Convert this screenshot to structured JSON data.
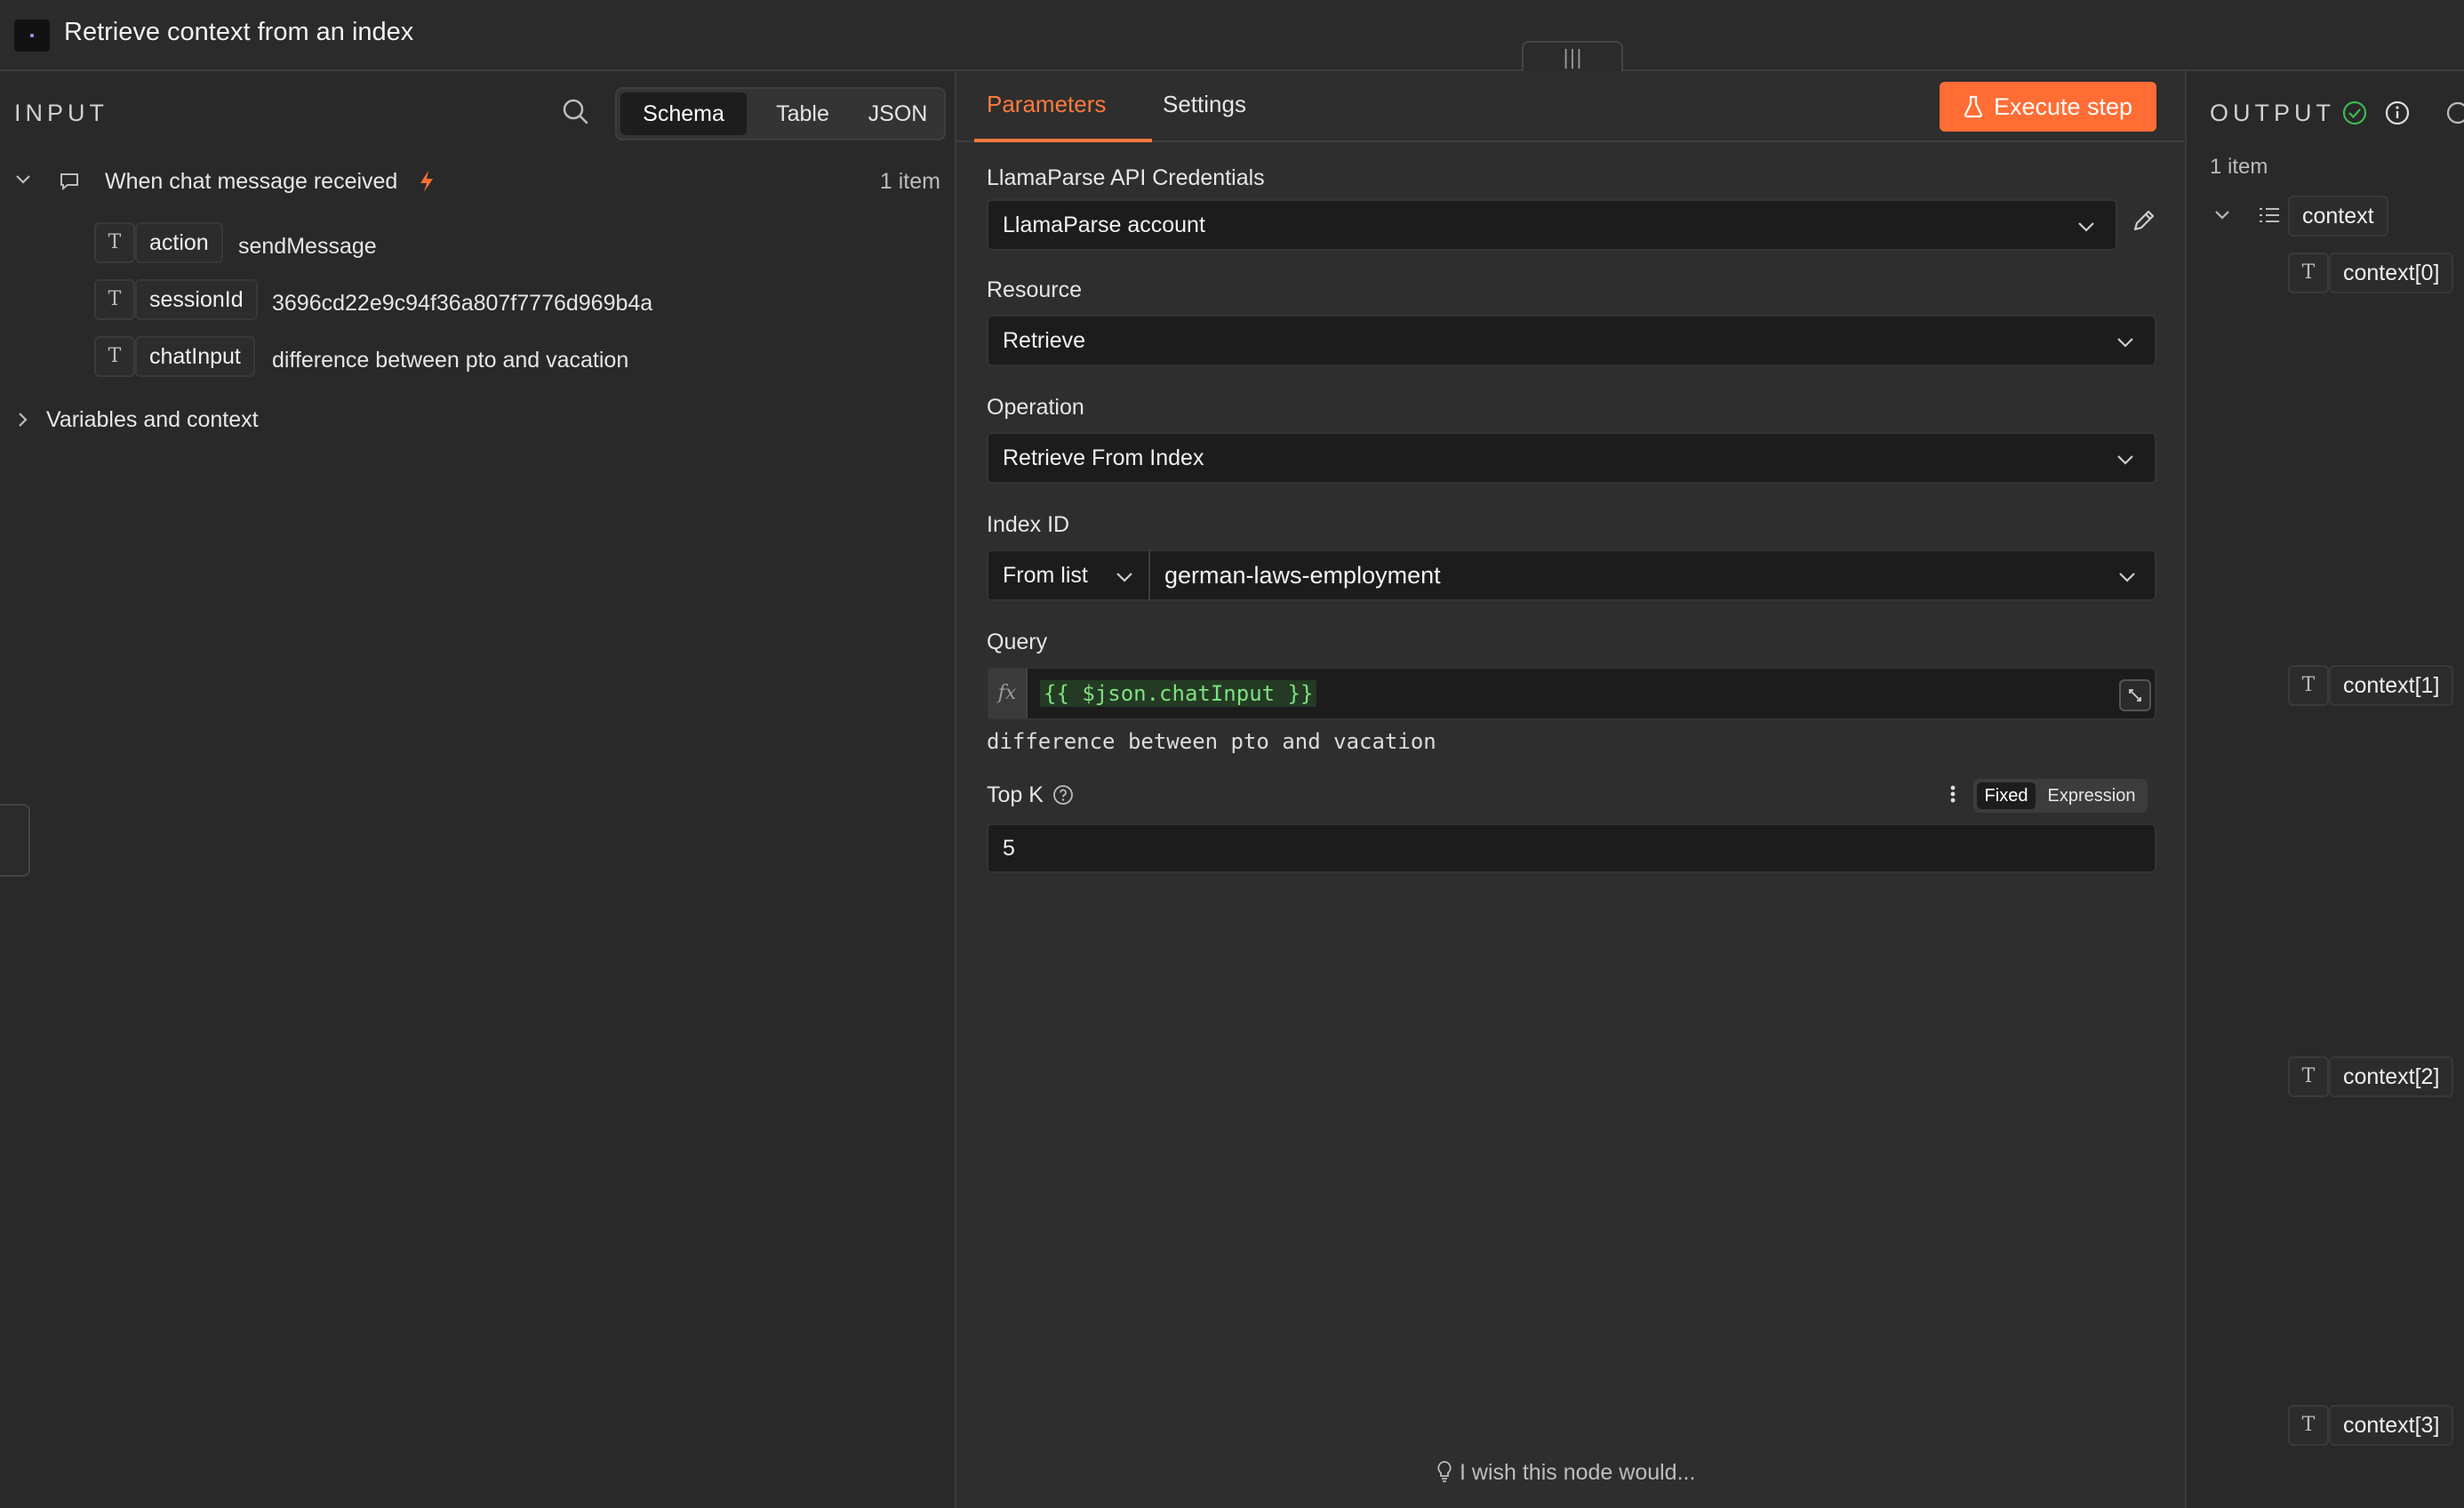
{
  "header": {
    "title": "Retrieve context from an index",
    "drag_handle": "|||"
  },
  "input": {
    "label": "INPUT",
    "views": [
      "Schema",
      "Table",
      "JSON"
    ],
    "active_view": "Schema",
    "trigger": {
      "name": "When chat message received",
      "count": "1 item",
      "fields": [
        {
          "type": "T",
          "key": "action",
          "value": "sendMessage"
        },
        {
          "type": "T",
          "key": "sessionId",
          "value": "3696cd22e9c94f36a807f7776d969b4a"
        },
        {
          "type": "T",
          "key": "chatInput",
          "value": "difference between pto and vacation"
        }
      ]
    },
    "variables_label": "Variables and context"
  },
  "params": {
    "tabs": [
      "Parameters",
      "Settings"
    ],
    "execute_label": "Execute step",
    "credentials_label": "LlamaParse API Credentials",
    "credentials_value": "LlamaParse account",
    "resource_label": "Resource",
    "resource_value": "Retrieve",
    "operation_label": "Operation",
    "operation_value": "Retrieve From Index",
    "index_label": "Index ID",
    "index_mode": "From list",
    "index_value": "german-laws-employment",
    "query_label": "Query",
    "query_fx": "fx",
    "query_expression": "{{ $json.chatInput }}",
    "query_result": "difference between pto and vacation",
    "topk_label": "Top K",
    "topk_modes": [
      "Fixed",
      "Expression"
    ],
    "topk_value": "5",
    "wish_text": "I wish this node would..."
  },
  "output": {
    "label": "OUTPUT",
    "count": "1 item",
    "root": "context",
    "type_symbol": "T",
    "items": [
      "context[0]",
      "context[1]",
      "context[2]",
      "context[3]"
    ]
  },
  "colors": {
    "accent": "#ff6d35",
    "success": "#3fb950",
    "expression": "#7ee07e"
  }
}
